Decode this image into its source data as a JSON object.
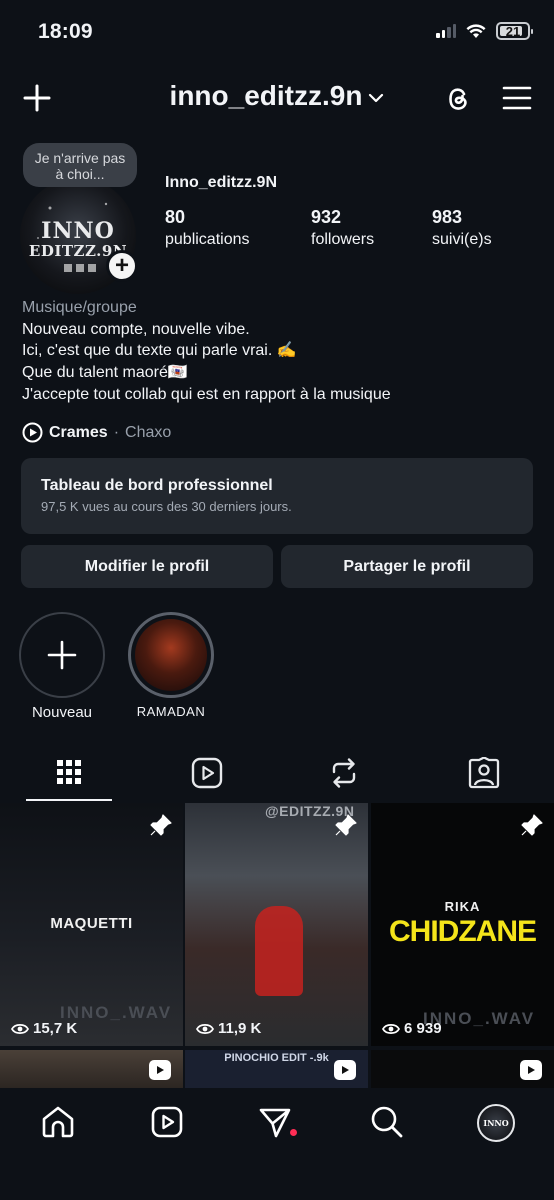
{
  "status": {
    "time": "18:09",
    "battery": "21"
  },
  "topbar": {
    "username": "inno_editzz.9n"
  },
  "profile": {
    "note": "Je n'arrive pas à choi...",
    "avatar_line1": "INNO",
    "avatar_line2": "EDITZZ.9N",
    "display_name": "Inno_editzz.9N",
    "stats": [
      {
        "value": "80",
        "label": "publications"
      },
      {
        "value": "932",
        "label": "followers"
      },
      {
        "value": "983",
        "label": "suivi(e)s"
      }
    ]
  },
  "bio": {
    "category": "Musique/groupe",
    "lines": [
      "Nouveau compte, nouvelle vibe.",
      "Ici, c'est que du texte qui parle vrai. ✍️",
      "Que du talent maoré🇾🇹",
      "J'accepte tout collab qui est en rapport à la musique"
    ]
  },
  "music": {
    "song": "Crames",
    "separator": "·",
    "artist": "Chaxo"
  },
  "dashboard": {
    "title": "Tableau de bord professionnel",
    "subtitle": "97,5 K vues au cours des 30 derniers jours."
  },
  "buttons": {
    "edit": "Modifier le profil",
    "share": "Partager le profil"
  },
  "highlights": [
    {
      "label": "Nouveau"
    },
    {
      "label": "RAMADAN"
    }
  ],
  "grid": [
    {
      "caption": "MAQUETTI",
      "views": "15,7 K",
      "watermark": "INNO_.WAV"
    },
    {
      "caption": "@EDITZZ.9N",
      "views": "11,9 K",
      "watermark": ""
    },
    {
      "caption": "RIKA",
      "caption2": "CHIDZANE",
      "views": "6 939",
      "watermark": "INNO_.WAV"
    }
  ],
  "grid_row2": [
    {
      "caption": ""
    },
    {
      "caption": "PINOCHIO EDIT -.9k"
    },
    {
      "caption": ""
    }
  ],
  "colors": {
    "background": "#0d1117",
    "card": "#22272e",
    "accent_yellow": "#f4e41a",
    "notif": "#ff2d55"
  }
}
